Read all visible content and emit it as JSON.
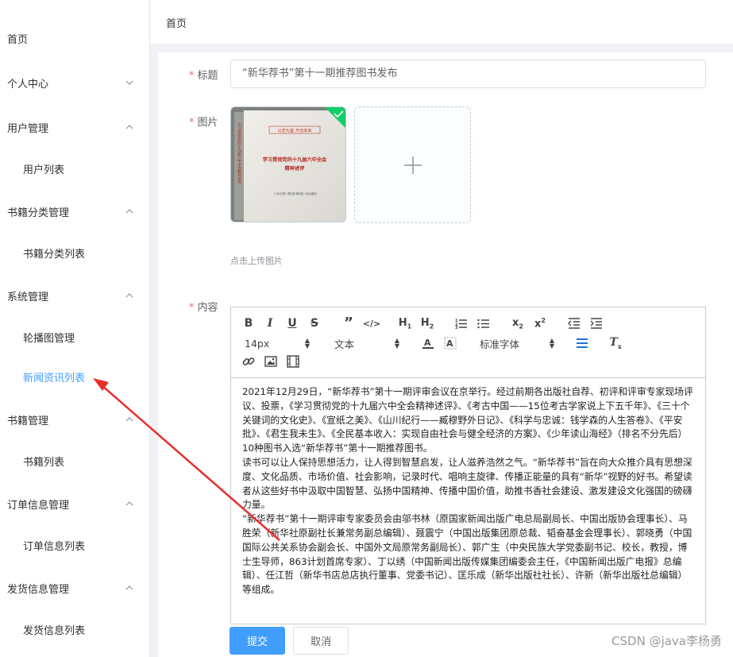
{
  "breadcrumb": "首页",
  "sidebar": {
    "items": [
      {
        "label": "首页",
        "type": "top"
      },
      {
        "label": "个人中心",
        "type": "top",
        "chevron": "down"
      },
      {
        "label": "用户管理",
        "type": "top",
        "chevron": "up"
      },
      {
        "label": "用户列表",
        "type": "sub"
      },
      {
        "label": "书籍分类管理",
        "type": "top",
        "chevron": "up"
      },
      {
        "label": "书籍分类列表",
        "type": "sub"
      },
      {
        "label": "系统管理",
        "type": "top",
        "chevron": "up"
      },
      {
        "label": "轮播图管理",
        "type": "sub"
      },
      {
        "label": "新闻资讯列表",
        "type": "sub",
        "active": true
      },
      {
        "label": "书籍管理",
        "type": "top",
        "chevron": "up"
      },
      {
        "label": "书籍列表",
        "type": "sub"
      },
      {
        "label": "订单信息管理",
        "type": "top",
        "chevron": "up"
      },
      {
        "label": "订单信息列表",
        "type": "sub"
      },
      {
        "label": "发货信息管理",
        "type": "top",
        "chevron": "up"
      },
      {
        "label": "发货信息列表",
        "type": "sub"
      }
    ]
  },
  "form": {
    "required_mark": "*",
    "title_label": "标题",
    "title_value": "“新华荐书”第十一期推荐图书发布",
    "image_label": "图片",
    "upload_tip": "点击上传图片",
    "content_label": "内容",
    "cover": {
      "top_text": "以史为鉴 开创未来",
      "title": "学习贯彻党的十九届六中全会精神述评",
      "spine": "学习贯彻党的十九届六中全会精神述评",
      "publisher": "《人民日报》理论部 编写组 人民出版社"
    }
  },
  "editor": {
    "size_value": "14px",
    "header_value": "文本",
    "font_value": "标准字体",
    "tool_icons": [
      "bold-icon",
      "italic-icon",
      "underline-icon",
      "strike-icon",
      "blockquote-icon",
      "code-block-icon",
      "h1-icon",
      "h2-icon",
      "ordered-list-icon",
      "bullet-list-icon",
      "subscript-icon",
      "superscript-icon",
      "outdent-icon",
      "indent-icon",
      "font-color-icon",
      "background-color-icon",
      "align-icon",
      "clean-icon",
      "link-icon",
      "image-icon",
      "video-icon"
    ],
    "paragraphs": [
      "2021年12月29日，“新华荐书”第十一期评审会议在京举行。经过前期各出版社自荐、初评和评审专家现场评议、投票，《学习贯彻党的十九届六中全会精神述评》、《考古中国——15位考古学家说上下五千年》、《三十个关键词的文化史》、《宣纸之美》、《山川纪行——臧穆野外日记》、《科学与忠诚：钱学森的人生答卷》、《平安批》、《君生我未生》、《全民基本收入：实现自由社会与健全经济的方案》、《少年读山海经》（排名不分先后）10种图书入选“新华荐书”第十一期推荐图书。",
      "读书可以让人保持思想活力，让人得到智慧启发，让人滋养浩然之气。“新华荐书”旨在向大众推介具有思想深度、文化品质、市场价值、社会影响，记录时代、唱响主旋律、传播正能量的具有“新华”视野的好书。希望读者从这些好书中汲取中国智慧、弘扬中国精神、传播中国价值，助推书香社会建设、激发建设文化强国的磅礴力量。",
      "“新华荐书”第十一期评审专家委员会由邬书林（原国家新闻出版广电总局副局长、中国出版协会理事长）、马胜荣（新华社原副社长兼常务副总编辑）、聂震宁（中国出版集团原总裁、韬奋基金会理事长）、郭晓勇（中国国际公共关系协会副会长、中国外文局原常务副局长）、郭广生（中央民族大学党委副书记、校长，教授，博士生导师，863计划首席专家）、丁以绣（中国新闻出版传媒集团编委会主任，《中国新闻出版广电报》总编辑）、任江哲（新华书店总店执行董事、党委书记）、匡乐成（新华出版社社长）、许新（新华出版社总编辑）等组成。"
    ]
  },
  "buttons": {
    "submit": "提交",
    "cancel": "取消"
  },
  "watermark": "CSDN @java李杨勇",
  "colors": {
    "primary": "#409eff",
    "required": "#f56c6c",
    "annotation_arrow": "#e8302b"
  }
}
